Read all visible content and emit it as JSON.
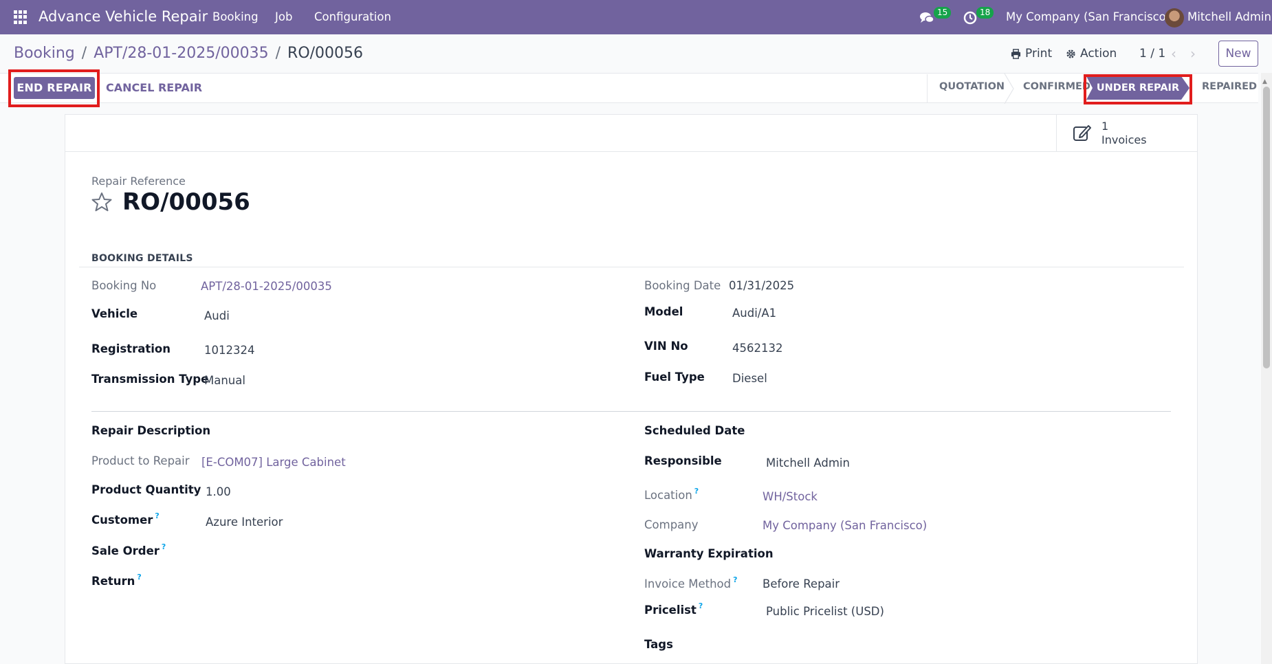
{
  "navbar": {
    "app_name": "Advance Vehicle Repair",
    "menu": [
      "Booking",
      "Job",
      "Configuration"
    ],
    "messages_count": "15",
    "activities_count": "18",
    "company": "My Company (San Francisco)",
    "user": "Mitchell Admin",
    "bg_color": "#71639e"
  },
  "breadcrumb": {
    "root": "Booking",
    "parent": "APT/28-01-2025/00035",
    "current": "RO/00056",
    "separator": "/"
  },
  "control": {
    "print": "Print",
    "action": "Action",
    "pager": "1 / 1",
    "new": "New"
  },
  "statusbar": {
    "end_repair": "END REPAIR",
    "cancel_repair": "CANCEL REPAIR",
    "stages": [
      "QUOTATION",
      "CONFIRMED",
      "UNDER REPAIR",
      "REPAIRED"
    ],
    "active_stage": "UNDER REPAIR"
  },
  "smart_button": {
    "value": "1",
    "label": "Invoices",
    "icon": "edit-icon"
  },
  "record": {
    "ref_label": "Repair Reference",
    "ref": "RO/00056"
  },
  "booking_details": {
    "title": "BOOKING DETAILS",
    "booking_no_label": "Booking No",
    "booking_no": "APT/28-01-2025/00035",
    "vehicle_label": "Vehicle",
    "vehicle": "Audi",
    "registration_label": "Registration",
    "registration": "1012324",
    "transmission_label": "Transmission Type",
    "transmission": "Manual",
    "booking_date_label": "Booking Date",
    "booking_date": "01/31/2025",
    "model_label": "Model",
    "model": "Audi/A1",
    "vin_label": "VIN No",
    "vin": "4562132",
    "fuel_label": "Fuel Type",
    "fuel": "Diesel"
  },
  "repair": {
    "description_label": "Repair Description",
    "product_label": "Product to Repair",
    "product": "[E-COM07] Large Cabinet",
    "quantity_label": "Product Quantity",
    "quantity": "1.00",
    "customer_label": "Customer",
    "customer": "Azure Interior",
    "sale_order_label": "Sale Order",
    "return_label": "Return",
    "scheduled_label": "Scheduled Date",
    "responsible_label": "Responsible",
    "responsible": "Mitchell Admin",
    "location_label": "Location",
    "location": "WH/Stock",
    "company_label": "Company",
    "company": "My Company (San Francisco)",
    "warranty_label": "Warranty Expiration",
    "invoice_method_label": "Invoice Method",
    "invoice_method": "Before Repair",
    "pricelist_label": "Pricelist",
    "pricelist": "Public Pricelist (USD)",
    "tags_label": "Tags",
    "help_mark": "?"
  }
}
